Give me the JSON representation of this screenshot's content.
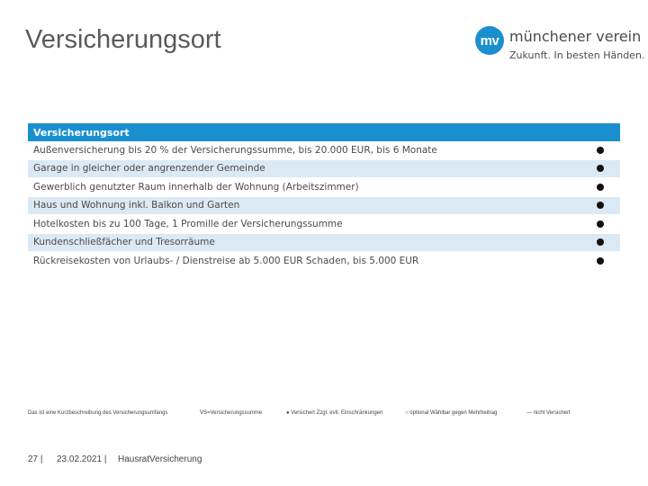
{
  "slide": {
    "title": "Versicherungsort"
  },
  "logo": {
    "mark": "mv",
    "name": "münchener verein",
    "tagline": "Zukunft. In besten Händen."
  },
  "table": {
    "header": "Versicherungsort",
    "rows": [
      {
        "label": "Außenversicherung bis 20 % der Versicherungssumme, bis 20.000 EUR, bis 6 Monate",
        "mark": "●"
      },
      {
        "label": "Garage in gleicher oder angrenzender Gemeinde",
        "mark": "●"
      },
      {
        "label": "Gewerblich genutzter Raum innerhalb der Wohnung (Arbeitszimmer)",
        "mark": "●"
      },
      {
        "label": "Haus und Wohnung inkl. Balkon und Garten",
        "mark": "●"
      },
      {
        "label": "Hotelkosten bis zu 100 Tage, 1 Promille der Versicherungssumme",
        "mark": "●"
      },
      {
        "label": "Kundenschließfächer und Tresorräume",
        "mark": "●"
      },
      {
        "label": "Rückreisekosten von Urlaubs- / Dienstreise ab 5.000 EUR Schaden, bis 5.000 EUR",
        "mark": "●"
      }
    ]
  },
  "footnotes": {
    "summary": "Das ist eine Kurzbeschreibung des Versicherungsumfangs",
    "vs": "VS=Versicherungssumme",
    "insured": "● Versichert Zzgl. evtl. Einschränkungen",
    "optional": "○ optional Wählbar gegen Mehrbeitrag",
    "not_insured": "--- nicht Versichert"
  },
  "footer": {
    "page": "27 |",
    "date": "23.02.2021 |",
    "product": "HausratVersicherung"
  },
  "colors": {
    "accent": "#1a8fd0",
    "row_alt": "#dbe9f5",
    "title": "#5a5a5a"
  }
}
